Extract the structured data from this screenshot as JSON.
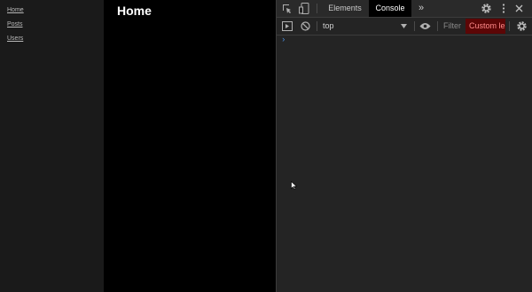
{
  "sidebar": {
    "links": [
      "Home",
      "Posts",
      "Users"
    ]
  },
  "main": {
    "title": "Home"
  },
  "devtools": {
    "tabs": [
      "Elements",
      "Console"
    ],
    "active_tab": "Console",
    "more_tabs_glyph": "»",
    "context": "top",
    "filter_placeholder": "Filter",
    "levels_label": "Custom le",
    "prompt_glyph": "›",
    "accent_levels_bg": "#5c0606"
  }
}
